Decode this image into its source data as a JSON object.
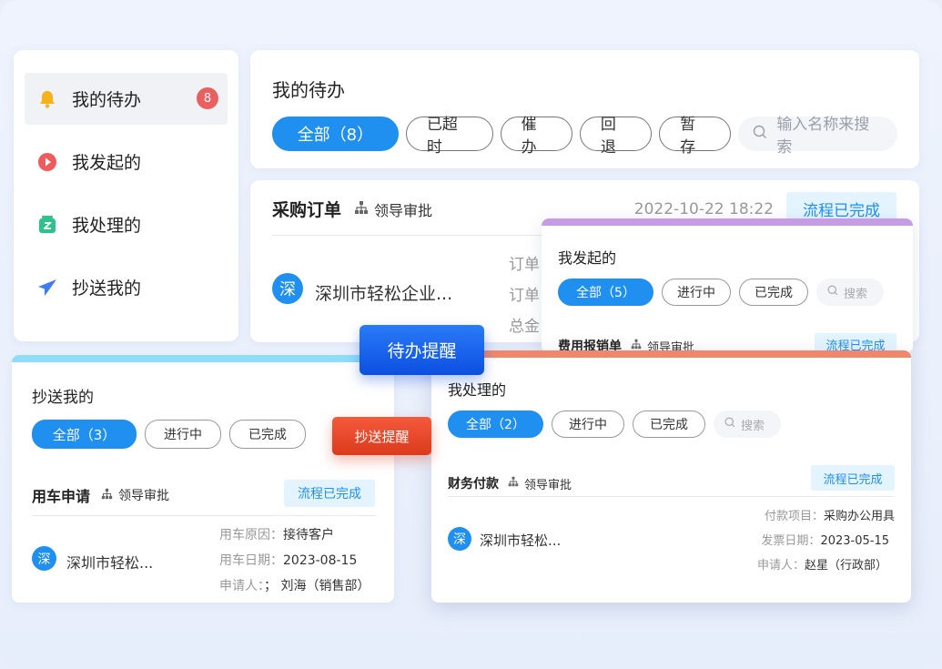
{
  "sidebar": {
    "items": [
      {
        "label": "我的待办",
        "badge": "8",
        "icon": "bell-icon",
        "color": "#f5b21c"
      },
      {
        "label": "我发起的",
        "icon": "play-circle-icon",
        "color": "#ef5b5b"
      },
      {
        "label": "我处理的",
        "icon": "edit-box-icon",
        "color": "#2ec28a"
      },
      {
        "label": "抄送我的",
        "icon": "paper-plane-icon",
        "color": "#3f7cf2"
      }
    ]
  },
  "todo": {
    "title": "我的待办",
    "filters": [
      "全部（8）",
      "已超时",
      "催办",
      "回退",
      "暂存"
    ],
    "search_placeholder": "输入名称来搜索",
    "card": {
      "title": "采购订单",
      "approval": "领导审批",
      "date": "2022-10-22  18:22",
      "status": "流程已完成",
      "avatar": "深",
      "company": "深圳市轻松企业...",
      "meta_labels": [
        "订单",
        "订单",
        "总金"
      ]
    }
  },
  "initiated": {
    "title": "我发起的",
    "filters": [
      "全部（5）",
      "进行中",
      "已完成"
    ],
    "search_placeholder": "搜索",
    "card": {
      "title": "费用报销单",
      "approval": "领导审批",
      "status": "流程已完成"
    }
  },
  "cc": {
    "title": "抄送我的",
    "filters": [
      "全部（3）",
      "进行中",
      "已完成"
    ],
    "card": {
      "title": "用车申请",
      "approval": "领导审批",
      "status": "流程已完成",
      "avatar": "深",
      "company": "深圳市轻松...",
      "meta": [
        {
          "label": "用车原因：",
          "value": "接待客户"
        },
        {
          "label": "用车日期：",
          "value": "2023-08-15"
        },
        {
          "label": "申请人：",
          "value": "；  刘海（销售部）"
        }
      ]
    }
  },
  "handled": {
    "title": "我处理的",
    "filters": [
      "全部（2）",
      "进行中",
      "已完成"
    ],
    "search_placeholder": "搜索",
    "card": {
      "title": "财务付款",
      "approval": "领导审批",
      "status": "流程已完成",
      "avatar": "深",
      "company": "深圳市轻松...",
      "meta": [
        {
          "label": "付款项目：",
          "value": "采购办公用具"
        },
        {
          "label": "发票日期：",
          "value": "2023-05-15"
        },
        {
          "label": "申请人：",
          "value": "赵星（行政部）"
        }
      ]
    }
  },
  "tags": {
    "todo_reminder": "待办提醒",
    "cc_reminder": "抄送提醒"
  }
}
